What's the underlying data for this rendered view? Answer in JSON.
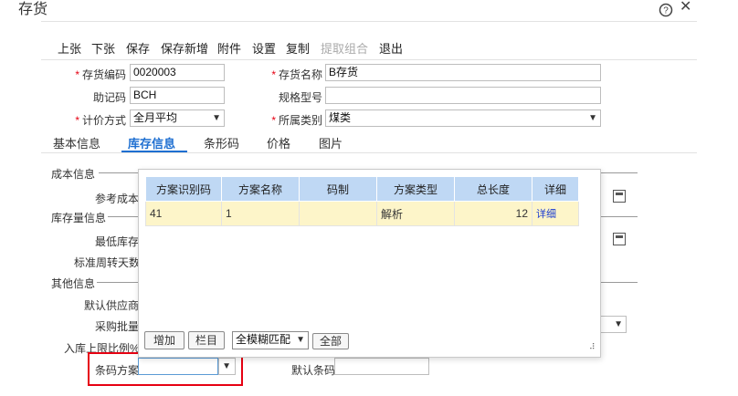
{
  "window": {
    "title": "存货",
    "help_icon": "?",
    "close_icon": "✕"
  },
  "toolbar": {
    "prev": "上张",
    "next": "下张",
    "save": "保存",
    "save_new": "保存新增",
    "attach": "附件",
    "settings": "设置",
    "copy": "复制",
    "fetch_combo": "提取组合",
    "exit": "退出"
  },
  "form": {
    "code_label": "存货编码",
    "code_value": "0020003",
    "name_label": "存货名称",
    "name_value": "B存货",
    "mnemonic_label": "助记码",
    "mnemonic_value": "BCH",
    "spec_label": "规格型号",
    "spec_value": "",
    "pricing_label": "计价方式",
    "pricing_value": "全月平均",
    "category_label": "所属类别",
    "category_value": "煤类"
  },
  "tabs": {
    "basic": "基本信息",
    "stock": "库存信息",
    "barcode": "条形码",
    "price": "价格",
    "image": "图片"
  },
  "sections": {
    "cost": "成本信息",
    "ref_cost": "参考成本",
    "stock_qty": "库存量信息",
    "min_stock": "最低库存",
    "turnover_days": "标准周转天数",
    "other": "其他信息",
    "default_supplier": "默认供应商",
    "purchase_batch": "采购批量",
    "inbound_ratio": "入库上限比例%",
    "barcode_scheme": "条码方案",
    "default_barcode": "默认条码"
  },
  "popup": {
    "headers": [
      "方案识别码",
      "方案名称",
      "码制",
      "方案类型",
      "总长度",
      "详细"
    ],
    "rows": [
      {
        "id": "41",
        "name": "1",
        "symbology": "",
        "type": "解析",
        "length": "12",
        "detail": "详细"
      }
    ],
    "add": "增加",
    "columns": "栏目",
    "match_mode": "全模糊匹配",
    "all": "全部",
    "resize_icon": "⠼"
  },
  "colors": {
    "accent": "#1e6fd1",
    "required": "#e60012",
    "header_bg": "#bfd8f4",
    "row_bg": "#fdf5c9",
    "highlight_box": "#e60012"
  }
}
